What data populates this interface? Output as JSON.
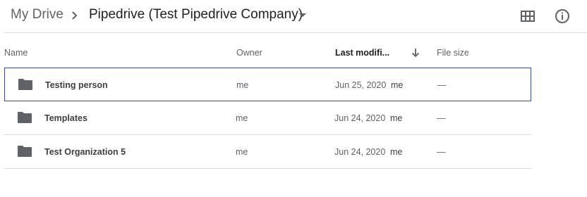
{
  "breadcrumb": {
    "root": "My Drive",
    "current": "Pipedrive (Test Pipedrive Company)"
  },
  "icons": {
    "grid_view": "grid-view-icon",
    "info": "info-icon",
    "sort": "arrow-down-icon",
    "folder": "folder-icon"
  },
  "table": {
    "headers": {
      "name": "Name",
      "owner": "Owner",
      "modified": "Last modifi...",
      "size": "File size"
    },
    "rows": [
      {
        "name": "Testing person",
        "owner": "me",
        "date": "Jun 25, 2020",
        "by": "me",
        "size": "—",
        "selected": true
      },
      {
        "name": "Templates",
        "owner": "me",
        "date": "Jun 24, 2020",
        "by": "me",
        "size": "—",
        "selected": false
      },
      {
        "name": "Test Organization 5",
        "owner": "me",
        "date": "Jun 24, 2020",
        "by": "me",
        "size": "—",
        "selected": false
      }
    ]
  },
  "colors": {
    "selected_border": "#3b4a9a",
    "divider": "#dadce0",
    "folder": "#5f6368"
  }
}
